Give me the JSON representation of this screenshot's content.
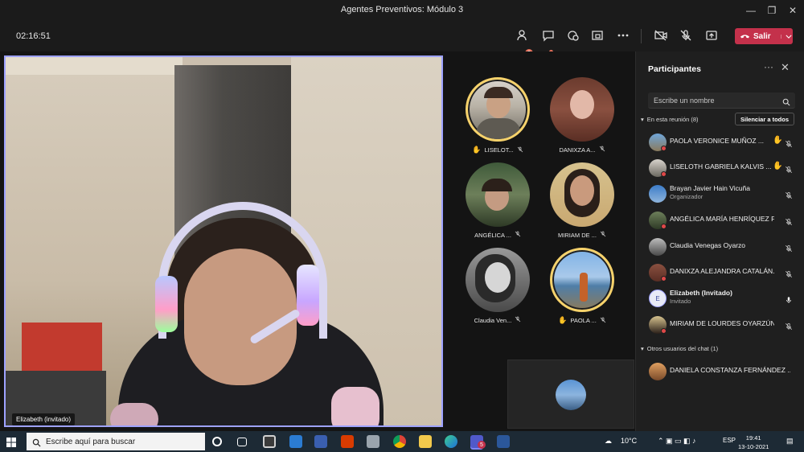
{
  "window": {
    "title": "Agentes Preventivos: Módulo 3"
  },
  "toolbar": {
    "timer": "02:16:51",
    "participants_badge": "2",
    "leave_label": "Salir",
    "icons": [
      "people-icon",
      "chat-icon",
      "reactions-icon",
      "rooms-icon",
      "more-icon",
      "camera-off-icon",
      "mic-off-icon",
      "share-icon",
      "phone-icon",
      "chevron-down-icon"
    ]
  },
  "main_video": {
    "name": "Elizabeth (invitado)"
  },
  "gallery": [
    {
      "label": "LISELOT...",
      "hand": true,
      "speaking": true,
      "avatar": "woman-short-hair"
    },
    {
      "label": "DANIXZA A...",
      "hand": false,
      "speaking": false,
      "avatar": "woman-long-hair"
    },
    {
      "label": "ANGÉLICA ...",
      "hand": false,
      "speaking": false,
      "avatar": "woman-outdoors"
    },
    {
      "label": "MIRIAM DE ...",
      "hand": false,
      "speaking": false,
      "avatar": "woman-dark-hair"
    },
    {
      "label": "Claudia Ven...",
      "hand": false,
      "speaking": false,
      "avatar": "woman-bw"
    },
    {
      "label": "PAOLA ...",
      "hand": true,
      "speaking": true,
      "avatar": "person-lake"
    }
  ],
  "panel": {
    "title": "Participantes",
    "search_placeholder": "Escribe un nombre",
    "in_meeting_label": "En esta reunión (8)",
    "mute_all_label": "Silenciar a todos",
    "others_label": "Otros usuarios del chat (1)",
    "participants": [
      {
        "name": "PAOLA VERONICE MUÑOZ ...",
        "role": "",
        "hand": true,
        "mic": "off"
      },
      {
        "name": "LISELOTH GABRIELA KALVIS ...",
        "role": "",
        "hand": true,
        "mic": "off"
      },
      {
        "name": "Brayan Javier Hain Vicuña",
        "role": "Organizador",
        "hand": false,
        "mic": "off"
      },
      {
        "name": "ANGÉLICA MARÍA HENRÍQUEZ F...",
        "role": "",
        "hand": false,
        "mic": "off"
      },
      {
        "name": "Claudia Venegas Oyarzo",
        "role": "",
        "hand": false,
        "mic": "off"
      },
      {
        "name": "DANIXZA ALEJANDRA CATALÁN...",
        "role": "",
        "hand": false,
        "mic": "off"
      },
      {
        "name": "Elizabeth (Invitado)",
        "role": "Invitado",
        "hand": false,
        "mic": "on",
        "initial": "E"
      },
      {
        "name": "MIRIAM DE LOURDES OYARZÚN...",
        "role": "",
        "hand": false,
        "mic": "off"
      }
    ],
    "others": [
      {
        "name": "DANIELA CONSTANZA FERNÁNDEZ ..."
      }
    ]
  },
  "taskbar": {
    "search_placeholder": "Escribe aquí para buscar",
    "weather": "10°C",
    "language": "ESP",
    "time": "19:41",
    "date": "13-10-2021",
    "teams_badge": "5"
  }
}
